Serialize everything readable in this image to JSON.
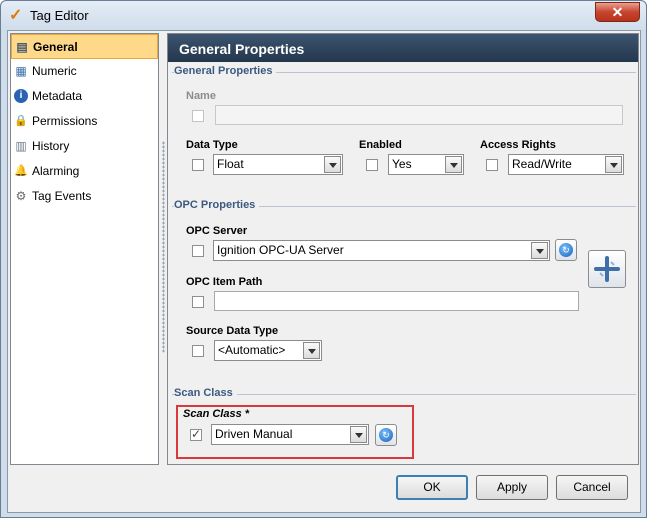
{
  "window": {
    "title": "Tag Editor",
    "close_glyph": "✕"
  },
  "nav": {
    "items": [
      {
        "label": "General",
        "icon": "general-icon",
        "glyph": "▤"
      },
      {
        "label": "Numeric",
        "icon": "numeric-icon",
        "glyph": "▦"
      },
      {
        "label": "Metadata",
        "icon": "info-icon",
        "glyph": "i"
      },
      {
        "label": "Permissions",
        "icon": "lock-icon",
        "glyph": "🔒"
      },
      {
        "label": "History",
        "icon": "history-icon",
        "glyph": "▥"
      },
      {
        "label": "Alarming",
        "icon": "bell-icon",
        "glyph": "🔔"
      },
      {
        "label": "Tag Events",
        "icon": "gears-icon",
        "glyph": "⚙"
      }
    ],
    "selected": "General"
  },
  "panel": {
    "header": "General Properties",
    "general": {
      "section_title": "General Properties",
      "name_label": "Name",
      "name_value": "",
      "data_type_label": "Data Type",
      "data_type_value": "Float",
      "enabled_label": "Enabled",
      "enabled_value": "Yes",
      "access_rights_label": "Access Rights",
      "access_rights_value": "Read/Write"
    },
    "opc": {
      "section_title": "OPC Properties",
      "server_label": "OPC Server",
      "server_value": "Ignition OPC-UA Server",
      "item_path_label": "OPC Item Path",
      "item_path_value": "",
      "source_type_label": "Source Data Type",
      "source_type_value": "<Automatic>"
    },
    "scan": {
      "section_title": "Scan Class",
      "label": "Scan Class *",
      "value": "Driven Manual",
      "checked": true
    }
  },
  "buttons": {
    "ok": "OK",
    "apply": "Apply",
    "cancel": "Cancel"
  },
  "colors": {
    "accent_selected": "#ffd98a",
    "header_bg": "#2c4259",
    "highlight_box": "#d9393d"
  }
}
